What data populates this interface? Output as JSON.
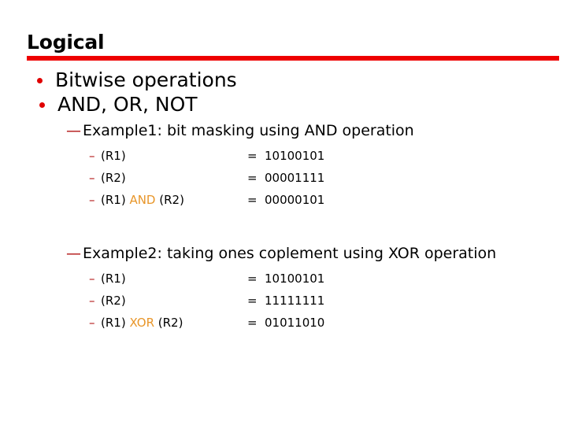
{
  "slide": {
    "title": "Logical",
    "rule_color": "#ee0000",
    "bullet_color": "#e00000",
    "dash_color": "#b01010",
    "operator_color": "#e8962a",
    "text_color": "#000000",
    "background_color": "#ffffff"
  },
  "bullets": [
    {
      "marker": "•",
      "text": "Bitwise operations"
    },
    {
      "marker": "•",
      "text": "AND, OR, NOT"
    }
  ],
  "examples": [
    {
      "marker": "—",
      "heading": "Example1: bit masking using AND operation",
      "rows": [
        {
          "marker": "–",
          "left_prefix": "(R1)",
          "operator": "",
          "left_suffix": "",
          "equals": "=",
          "value": "10100101"
        },
        {
          "marker": "–",
          "left_prefix": "(R2)",
          "operator": "",
          "left_suffix": "",
          "equals": "=",
          "value": "00001111"
        },
        {
          "marker": "–",
          "left_prefix": "(R1) ",
          "operator": "AND",
          "left_suffix": " (R2)",
          "equals": "=",
          "value": "00000101"
        }
      ]
    },
    {
      "marker": "—",
      "heading": "Example2: taking ones coplement using XOR operation",
      "rows": [
        {
          "marker": "–",
          "left_prefix": "(R1)",
          "operator": "",
          "left_suffix": "",
          "equals": "=",
          "value": "10100101"
        },
        {
          "marker": "–",
          "left_prefix": "(R2)",
          "operator": "",
          "left_suffix": "",
          "equals": "=",
          "value": "11111111"
        },
        {
          "marker": "–",
          "left_prefix": "(R1) ",
          "operator": "XOR",
          "left_suffix": " (R2)",
          "equals": "=",
          "value": "01011010"
        }
      ]
    }
  ]
}
